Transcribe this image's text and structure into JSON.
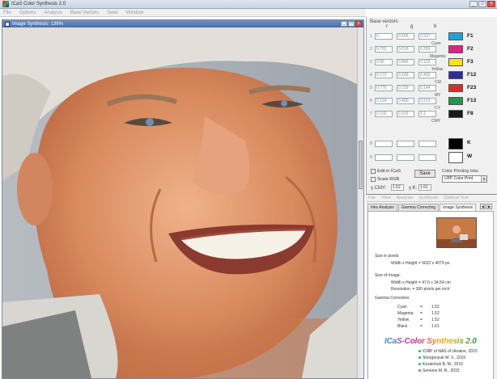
{
  "app": {
    "title": "ICaS Color Synthesis 2.0",
    "menu": [
      "File",
      "Options",
      "Analysis",
      "Base Vectors",
      "Save",
      "Window"
    ]
  },
  "image_window": {
    "title": "Image Synthesis: 136%"
  },
  "base_vectors": {
    "label": "Base vectors",
    "col_r": "r",
    "col_g": "g",
    "col_b": "b",
    "rows": [
      {
        "num": "1",
        "r": "0",
        "g": "0.506",
        "b": "0.927",
        "sub": "Cyan",
        "swatch": "#1aa3e0",
        "label": "F1"
      },
      {
        "num": "2",
        "r": "0.752",
        "g": "0.018",
        "b": "0.359",
        "sub": "Magenta",
        "swatch": "#e0218a",
        "label": "F2"
      },
      {
        "num": "3",
        "r": "0.95",
        "g": "0.866",
        "b": "0.125",
        "sub": "Yellow",
        "swatch": "#f5e21c",
        "label": "F3"
      },
      {
        "num": "4",
        "r": "0.172",
        "g": "0.183",
        "b": "0.402",
        "sub": "CM",
        "swatch": "#2b2f8f",
        "label": "F12"
      },
      {
        "num": "5",
        "r": "0.776",
        "g": "0.159",
        "b": "0.144",
        "sub": "MY",
        "swatch": "#e02a2a",
        "label": "F23"
      },
      {
        "num": "6",
        "r": "0.124",
        "g": "0.460",
        "b": "0.213",
        "sub": "CY",
        "swatch": "#1a9a4a",
        "label": "F13"
      },
      {
        "num": "7",
        "r": "0.102",
        "g": "0.102",
        "b": "0.1",
        "sub": "CMY",
        "swatch": "#1a1a1a",
        "label": "F8"
      }
    ],
    "k": {
      "num": "8",
      "swatch": "#000000",
      "label": "K"
    },
    "w": {
      "num": "9",
      "swatch": "#ffffff",
      "label": "W"
    }
  },
  "controls": {
    "edit_label": "Edit in ICaS",
    "scale_label": "Scale RGB",
    "save_label": "Save",
    "color_printing_label": "Color Printing Inks",
    "color_printing_value": "UPP Color Print",
    "gamma_cmy_label": "γ CMY:",
    "gamma_cmy_value": "1.52",
    "gamma_k_label": "γ K:",
    "gamma_k_value": "1.61"
  },
  "subwindow": {
    "menu": [
      "File",
      "View",
      "Analysis",
      "Synthesis",
      "Optimal Text"
    ],
    "tabs": [
      "Inks Analysis",
      "Gamma Correcting",
      "Image Synthesis"
    ],
    "size_pixels_label": "Size in pixels:",
    "size_pixels_value": "Width x Height = 5622 x 4079 px",
    "size_image_label": "Size of Image:",
    "size_image_value": "Width x Height = 47.6 x 34.54 cm",
    "resolution": "Resolution:      = 300 pixels per inch",
    "gamma_label": "Gamma Correction:",
    "gamma_rows": [
      {
        "name": "Cyan",
        "value": "1.52"
      },
      {
        "name": "Magenta",
        "value": "1.52"
      },
      {
        "name": "Yellow",
        "value": "1.52"
      },
      {
        "name": "Black",
        "value": "1.61"
      }
    ],
    "logo": "ICaS-Color Synthesis 2.0",
    "credits": [
      "ICMP of NAS of Ukraine, 2015",
      "Shorgenyuk M. V., 2015",
      "Kovalchuk B. M., 2015",
      "Senenin M. R., 2015"
    ]
  }
}
